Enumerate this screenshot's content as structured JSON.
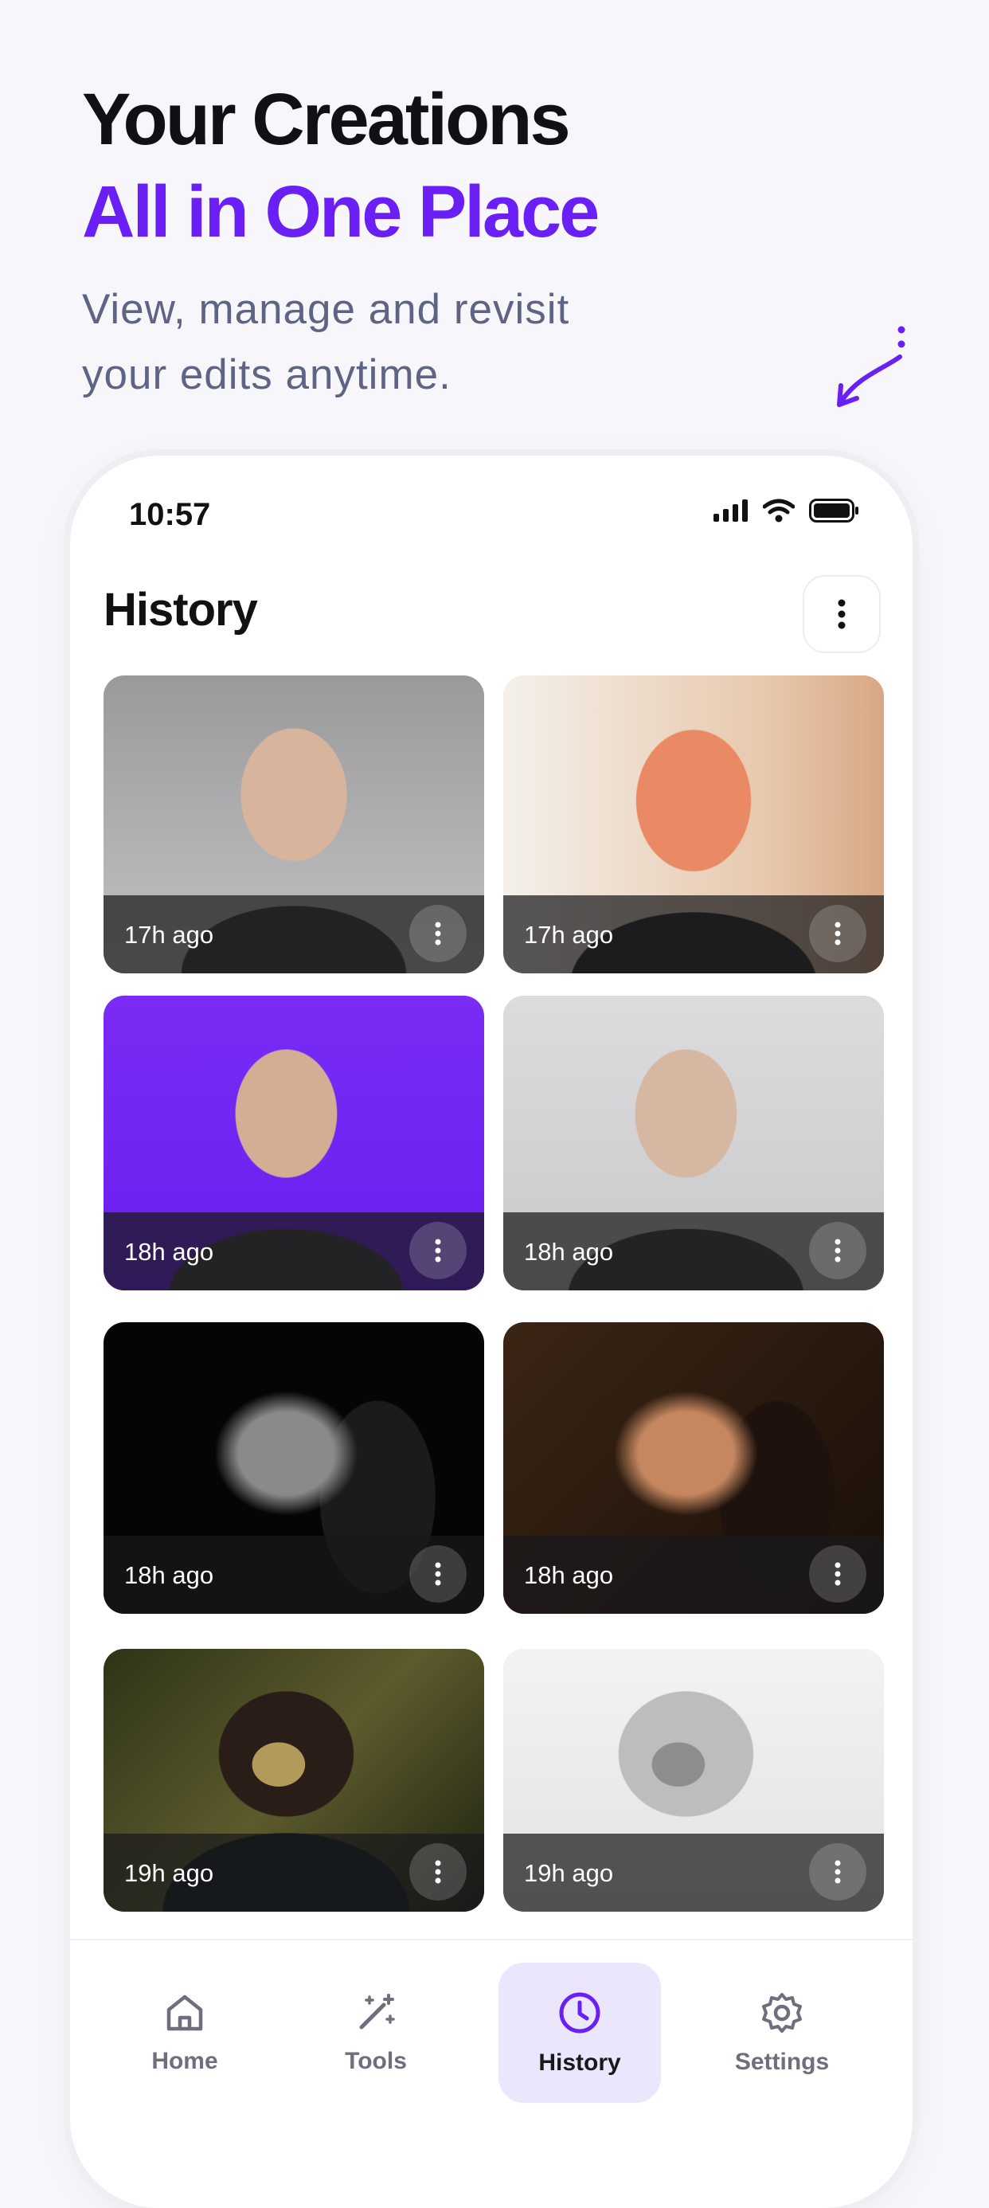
{
  "hero": {
    "title_line1": "Your Creations",
    "title_line2": "All in One Place",
    "subtitle_line1": "View, manage and revisit",
    "subtitle_line2": "your edits anytime."
  },
  "status_bar": {
    "time": "10:57"
  },
  "header": {
    "title": "History"
  },
  "cards": [
    {
      "time": "17h ago",
      "style": "gray-portrait-man"
    },
    {
      "time": "17h ago",
      "style": "cartoon-smiling-man"
    },
    {
      "time": "18h ago",
      "style": "purple-background-man"
    },
    {
      "time": "18h ago",
      "style": "light-gray-man"
    },
    {
      "time": "18h ago",
      "style": "black-white-woman-profile"
    },
    {
      "time": "18h ago",
      "style": "warm-toned-woman-profile"
    },
    {
      "time": "19h ago",
      "style": "photographer-with-camera"
    },
    {
      "time": "19h ago",
      "style": "sketch-photographer"
    }
  ],
  "tabs": [
    {
      "label": "Home",
      "icon": "home-icon",
      "active": false
    },
    {
      "label": "Tools",
      "icon": "magic-wand-icon",
      "active": false
    },
    {
      "label": "History",
      "icon": "clock-icon",
      "active": true
    },
    {
      "label": "Settings",
      "icon": "gear-icon",
      "active": false
    }
  ],
  "colors": {
    "accent": "#6a1ff5",
    "subtitle": "#5f6384",
    "active_tab_bg": "#ece6fd"
  }
}
